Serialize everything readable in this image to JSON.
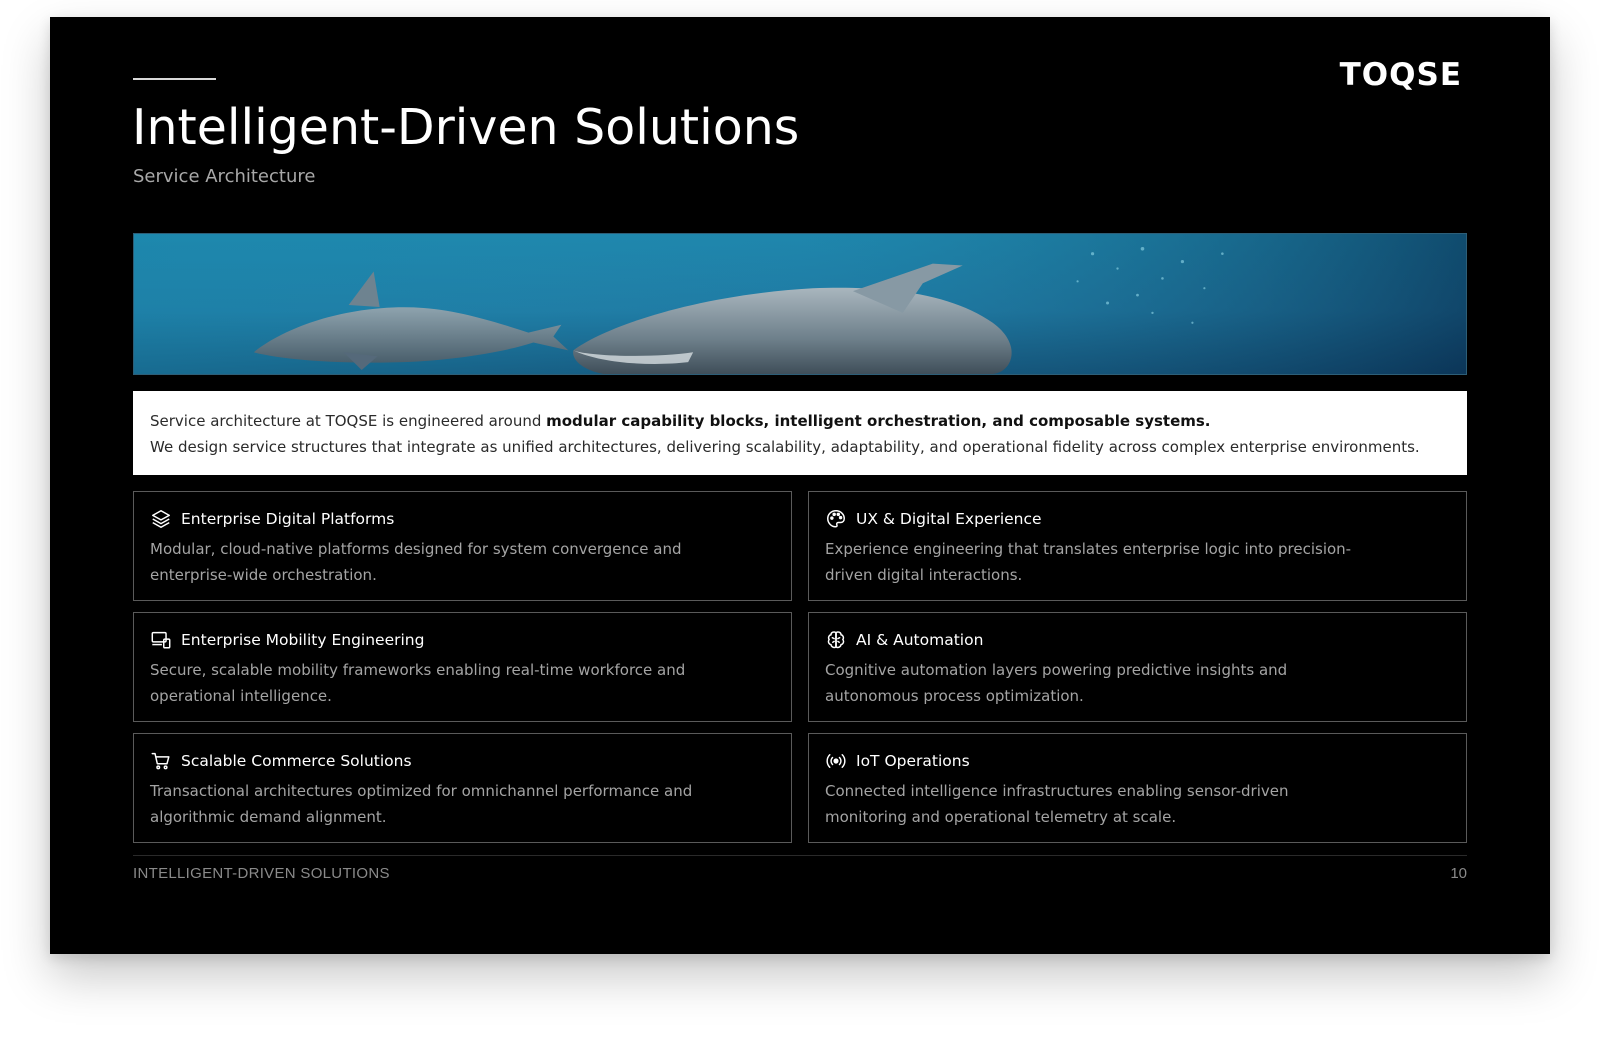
{
  "brand": {
    "logo_text": "TOQSE"
  },
  "header": {
    "title": "Intelligent-Driven Solutions",
    "subtitle": "Service Architecture"
  },
  "hero": {
    "image_description": "dolphins-underwater"
  },
  "intro": {
    "lead": "Service architecture at TOQSE is engineered around ",
    "emphasis": "modular capability blocks, intelligent orchestration, and composable systems.",
    "line2": "We design service structures that integrate as unified architectures, delivering scalability, adaptability, and operational fidelity across complex enterprise environments."
  },
  "cards": [
    {
      "icon": "layers-icon",
      "title": "Enterprise Digital Platforms",
      "description": "Modular, cloud-native platforms designed for system convergence and enterprise-wide orchestration."
    },
    {
      "icon": "palette-icon",
      "title": "UX & Digital Experience",
      "description": "Experience engineering that translates enterprise logic into precision-driven digital interactions."
    },
    {
      "icon": "devices-icon",
      "title": "Enterprise Mobility Engineering",
      "description": "Secure, scalable mobility frameworks enabling real-time workforce and operational intelligence."
    },
    {
      "icon": "brain-icon",
      "title": "AI & Automation",
      "description": "Cognitive automation layers powering predictive insights and autonomous process optimization."
    },
    {
      "icon": "cart-icon",
      "title": "Scalable Commerce Solutions",
      "description": "Transactional architectures optimized for omnichannel performance and algorithmic demand alignment."
    },
    {
      "icon": "broadcast-icon",
      "title": "IoT Operations",
      "description": "Connected intelligence infrastructures enabling sensor-driven monitoring and operational telemetry at scale."
    }
  ],
  "footer": {
    "label": "INTELLIGENT-DRIVEN SOLUTIONS",
    "page_number": "10"
  }
}
